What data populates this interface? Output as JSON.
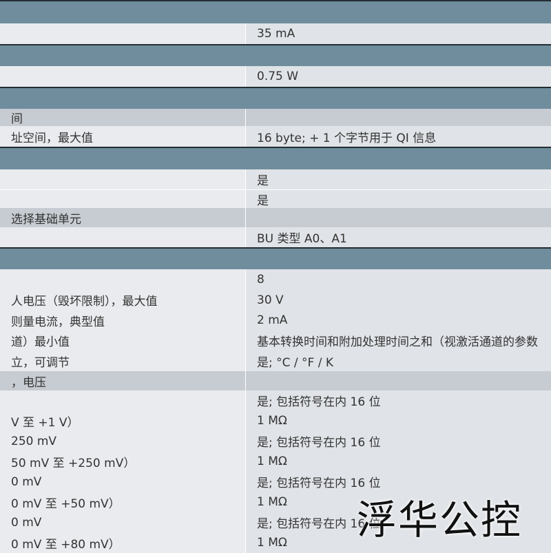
{
  "rows": [
    {
      "kind": "section"
    },
    {
      "kind": "data",
      "label": "",
      "value": "35 mA"
    },
    {
      "kind": "section"
    },
    {
      "kind": "data",
      "label": "",
      "value": "0.75 W"
    },
    {
      "kind": "section"
    },
    {
      "kind": "sub",
      "label": "间"
    },
    {
      "kind": "data",
      "label": "址空间，最大值",
      "value": "16 byte; + 1 个字节用于 QI 信息"
    },
    {
      "kind": "section"
    },
    {
      "kind": "data",
      "label": "",
      "value": "是"
    },
    {
      "kind": "data",
      "label": "",
      "value": "是"
    },
    {
      "kind": "sub",
      "label": "选择基础单元"
    },
    {
      "kind": "data",
      "label": "",
      "value": "BU 类型 A0、A1"
    },
    {
      "kind": "section"
    },
    {
      "kind": "data",
      "label": "",
      "value": "8"
    },
    {
      "kind": "data",
      "label": "人电压（毁坏限制），最大值",
      "value": "30 V"
    },
    {
      "kind": "data",
      "label": "则量电流，典型值",
      "value": "2 mA"
    },
    {
      "kind": "data",
      "label": "道）最小值",
      "value": "基本转换时间和附加处理时间之和（视激活通道的参数"
    },
    {
      "kind": "data",
      "label": "立，可调节",
      "value": "是; °C / °F / K"
    },
    {
      "kind": "sub",
      "label": "，电压"
    },
    {
      "kind": "data",
      "label": "",
      "value": "是; 包括符号在内 16 位"
    },
    {
      "kind": "data",
      "label": "V 至 +1 V）",
      "value": "1 MΩ"
    },
    {
      "kind": "data",
      "label": "250 mV",
      "value": "是; 包括符号在内 16 位"
    },
    {
      "kind": "data",
      "label": "50 mV 至 +250 mV）",
      "value": "1 MΩ"
    },
    {
      "kind": "data",
      "label": "0 mV",
      "value": "是; 包括符号在内 16 位"
    },
    {
      "kind": "data",
      "label": "0 mV 至 +50 mV）",
      "value": "1 MΩ"
    },
    {
      "kind": "data",
      "label": "0 mV",
      "value": "是; 包括符号在内 16 位"
    },
    {
      "kind": "data",
      "label": "0 mV 至 +80 mV）",
      "value": "1 MΩ"
    }
  ],
  "watermark": "浮华公控"
}
